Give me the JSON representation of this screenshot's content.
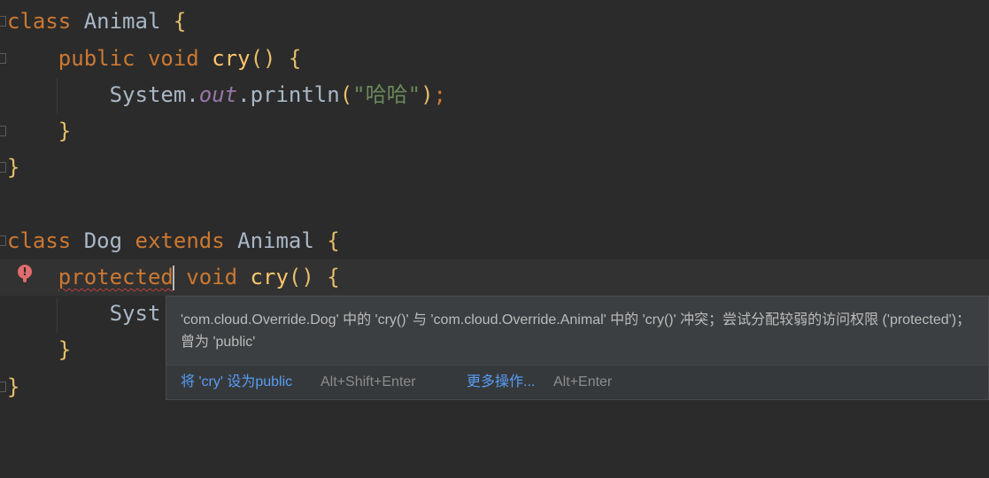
{
  "code": {
    "line1": {
      "kw": "class",
      "name": "Animal",
      "brace": "{"
    },
    "line2": {
      "kw1": "public",
      "kw2": "void",
      "fn": "cry",
      "parens": "()",
      "brace": "{"
    },
    "line3": {
      "obj": "System",
      "dot1": ".",
      "field": "out",
      "dot2": ".",
      "method": "println",
      "open": "(",
      "str": "\"哈哈\"",
      "close": ")",
      "semi": ";"
    },
    "line4": {
      "brace": "}"
    },
    "line5": {
      "brace": "}"
    },
    "line7": {
      "kw": "class",
      "name": "Dog",
      "kw2": "extends",
      "parent": "Animal",
      "brace": "{"
    },
    "line8": {
      "kw1": "protected",
      "kw2": "void",
      "fn": "cry",
      "parens": "()",
      "brace": "{"
    },
    "line9": {
      "obj": "Syst"
    },
    "line10": {
      "brace": "}"
    },
    "line11": {
      "brace": "}"
    }
  },
  "popup": {
    "message": "'com.cloud.Override.Dog' 中的 'cry()' 与 'com.cloud.Override.Animal' 中的 'cry()' 冲突；尝试分配较弱的访问权限 ('protected')；曾为 'public'",
    "action1_label": "将 'cry' 设为public",
    "action1_shortcut": "Alt+Shift+Enter",
    "action2_label": "更多操作...",
    "action2_shortcut": "Alt+Enter"
  },
  "colors": {
    "background": "#2b2b2b",
    "keyword": "#cc7832",
    "function": "#ffc66d",
    "string": "#6a8759",
    "field": "#9876aa",
    "error": "#bc3f3c",
    "link": "#589df6"
  },
  "icons": {
    "error_gutter": "error-bulb-icon",
    "fold": "fold-marker-icon"
  }
}
